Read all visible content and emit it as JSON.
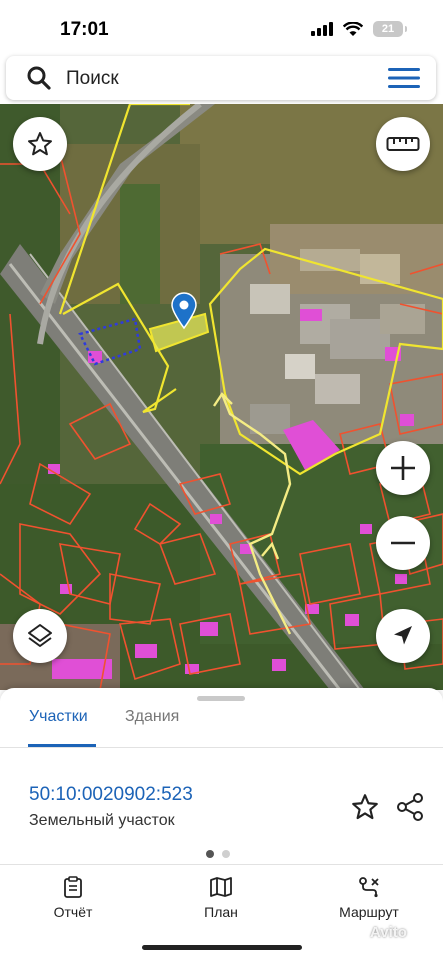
{
  "status_bar": {
    "time": "17:01",
    "battery": "21"
  },
  "search": {
    "placeholder": "Поиск"
  },
  "map": {
    "icons": [
      "star-icon",
      "ruler-icon",
      "zoom-in-icon",
      "zoom-out-icon",
      "layers-icon",
      "locate-icon",
      "location-pin-icon"
    ]
  },
  "sheet": {
    "tabs": [
      {
        "label": "Участки",
        "active": true
      },
      {
        "label": "Здания",
        "active": false
      }
    ],
    "parcel": {
      "cadastral_number": "50:10:0020902:523",
      "type": "Земельный участок"
    },
    "pager": {
      "pages": 2,
      "current": 1
    },
    "bottom_nav": [
      {
        "label": "Отчёт",
        "icon": "report-icon"
      },
      {
        "label": "План",
        "icon": "map-plan-icon"
      },
      {
        "label": "Маршрут",
        "icon": "route-icon"
      }
    ],
    "watermark": "Avito"
  },
  "colors": {
    "accent": "#1c63b7",
    "parcel_boundary": "#f0522f",
    "selected_parcel": "#e6e85a",
    "building": "#e04fd6",
    "route": "#f4ec84"
  }
}
